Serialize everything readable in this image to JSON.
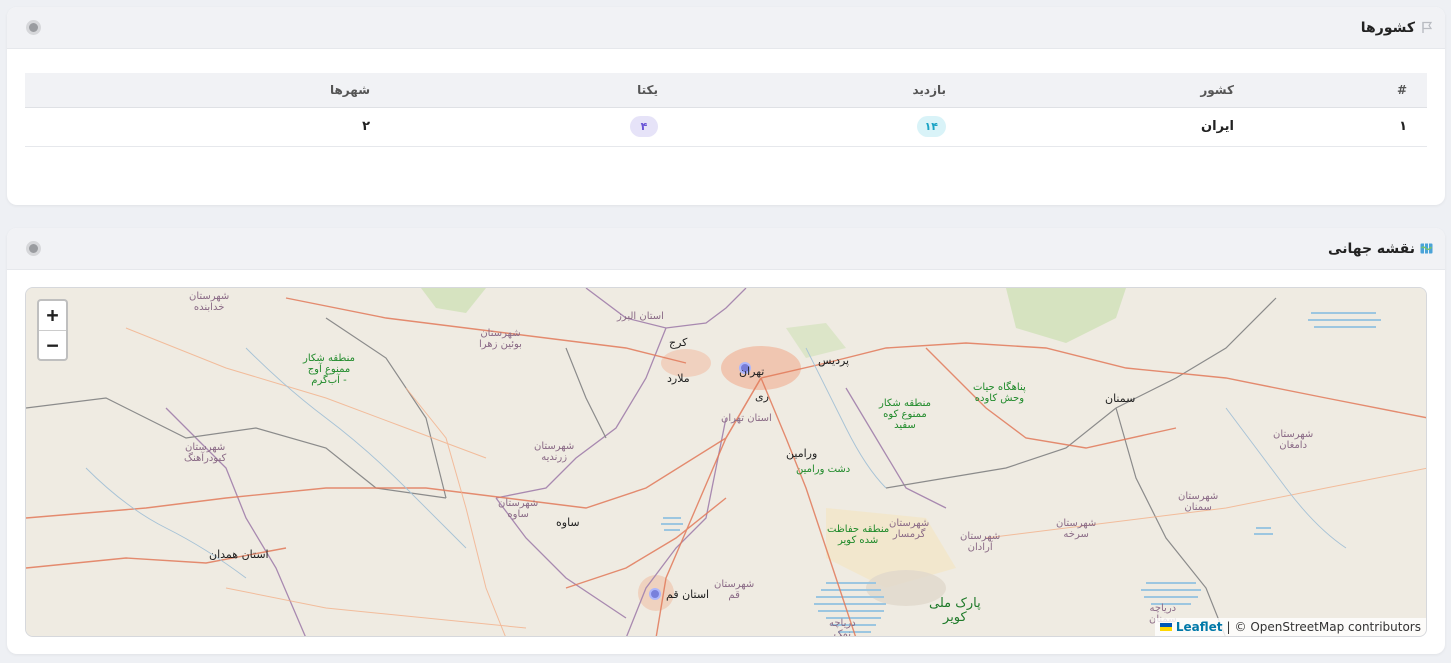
{
  "countries_card": {
    "title": "کشورها",
    "columns": [
      "#",
      "کشور",
      "بازدید",
      "یکتا",
      "شهرها"
    ],
    "rows": [
      {
        "index": "۱",
        "country": "ایران",
        "visits": "۱۴",
        "unique": "۴",
        "cities": "۲"
      }
    ]
  },
  "map_card": {
    "title": "نقشه جهانی",
    "zoom_in": "+",
    "zoom_out": "−",
    "attribution": {
      "leaflet": "Leaflet",
      "separator": "|",
      "osm": "© OpenStreetMap contributors"
    },
    "labels": {
      "tehran": "تهران",
      "karaj": "کرج",
      "alborz": "استان البرز",
      "malard": "ملارد",
      "pardis": "پردیس",
      "rey": "ری",
      "tehran_province": "استان تهران",
      "varamin": "ورامین",
      "dasht_varamin": "دشت ورامین",
      "semnan": "سمنان",
      "saveh_city": "ساوه",
      "saveh_county": "شهرستان\nساوه",
      "qom_province": "استان قم",
      "qom_county": "شهرستان\nقم",
      "hamedan": "استان همدان",
      "kabudarahang": "شهرستان\nکبودرآهنگ",
      "khodabandeh": "شهرستان\nخدابنده",
      "buin_zahra": "شهرستان\nبوئین زهرا",
      "zarandieh": "شهرستان\nزرندیه",
      "garmsar": "شهرستان\nگرمسار",
      "aradan": "شهرستان\nآرادان",
      "sorkheh": "شهرستان\nسرخه",
      "semnan_county": "شهرستان\nسمنان",
      "damghan": "شهرستان\nدامغان",
      "avaj": "منطقه شکار\nممنوع آوج\n- آب‌گرم",
      "kuh_sefid": "منطقه شکار\nممنوع کوه\nسفید",
      "kaveh_deh": "پناهگاه حیات\nوحش کاوده",
      "kavir_protected": "منطقه حفاظت\nشده کویر",
      "kavir_park": "پارک ملی\nکویر",
      "lake": "دریاچه\nنمک",
      "semnan_lake": "دریاچه\nسمنان"
    }
  }
}
